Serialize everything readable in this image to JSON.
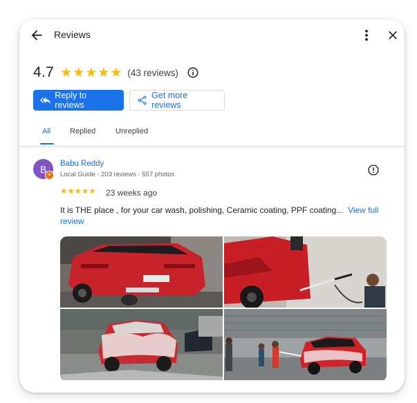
{
  "header": {
    "title": "Reviews",
    "back_icon": "arrow-back-icon",
    "more_icon": "more-vert-icon",
    "close_icon": "close-icon"
  },
  "summary": {
    "rating": "4.7",
    "stars": 5,
    "count_text": "(43 reviews)",
    "star_color": "#fbbc04"
  },
  "actions": {
    "reply_label": "Reply to reviews",
    "get_more_label": "Get more reviews",
    "accent": "#1a73e8"
  },
  "tabs": [
    {
      "label": "All",
      "active": true
    },
    {
      "label": "Replied",
      "active": false
    },
    {
      "label": "Unreplied",
      "active": false
    }
  ],
  "review": {
    "avatar_letter": "B",
    "avatar_color": "#7e57c2",
    "author": "Babu Reddy",
    "meta": "Local Guide · 203 reviews · 557 photos",
    "stars": 5,
    "time": "23 weeks ago",
    "text": "It is THE place , for your car wash, polishing, Ceramic coating, PPF coating...",
    "view_full": "View full review",
    "photos": [
      {
        "subject": "red-suv-rear-view"
      },
      {
        "subject": "pressure-washing-red-suv"
      },
      {
        "subject": "foamed-red-suv"
      },
      {
        "subject": "washing-bay-red-suv"
      }
    ]
  }
}
